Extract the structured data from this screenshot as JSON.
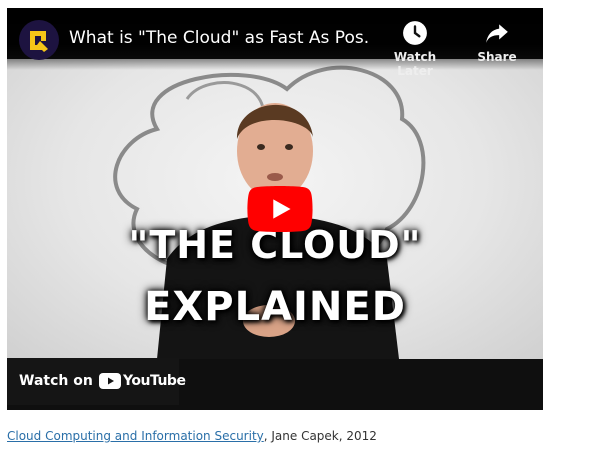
{
  "video": {
    "title": "What is \"The Cloud\" as Fast As Pos...",
    "overlay_line1": "\"THE CLOUD\"",
    "overlay_line2": "EXPLAINED",
    "watch_later_label": "Watch Later",
    "share_label": "Share",
    "watch_on_label": "Watch on",
    "youtube_word": "YouTube",
    "channel_logo_icon": "channel-logo-icon",
    "colors": {
      "play_red": "#ff0000",
      "player_bg": "#0f0f0f",
      "logo_yellow": "#f5c518"
    }
  },
  "citation": {
    "link_text": "Cloud Computing and Information Security",
    "rest_text": ", Jane Capek, 2012"
  }
}
